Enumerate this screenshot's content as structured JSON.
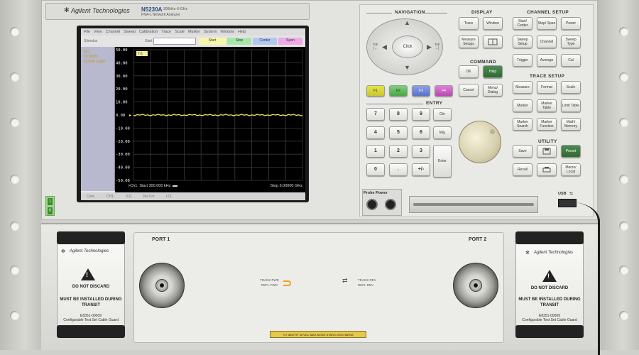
{
  "instrument": {
    "brand": "Agilent Technologies",
    "model": "N5230A",
    "model_range": "300kHz–6 GHz",
    "model_sub": "PNA-L Network Analyzer"
  },
  "screen": {
    "menu": [
      "File",
      "View",
      "Channel",
      "Sweep",
      "Calibration",
      "Trace",
      "Scale",
      "Marker",
      "System",
      "Window",
      "Help"
    ],
    "toolbar": {
      "mode_label": "Stimulus",
      "start_label": "Start",
      "start_value": "",
      "buttons": {
        "start": "Start",
        "stop": "Stop",
        "center": "Center",
        "span": "Span"
      }
    },
    "trace_label": {
      "line1": "S11",
      "line2": "10.00dB/",
      "line3": "0.00dB  LogM"
    },
    "marker_flag": "Tr1",
    "y_ticks": [
      "50.00",
      "40.00",
      "30.00",
      "20.00",
      "10.00",
      "0.00",
      "-10.00",
      "-20.00",
      "-30.00",
      "-40.00",
      "-50.00"
    ],
    "status_left": ">Ch1: Start  300.000 kHz",
    "status_right": "Stop  6.00000 GHz",
    "bottom_bar": [
      "Cont.",
      "CH1:",
      "S11",
      "No Cor",
      "LCL"
    ],
    "trace_color": "#f3ee6a",
    "grid_color": "#3a3a3a"
  },
  "led": {
    "top": "1",
    "bottom": "0"
  },
  "panel": {
    "navigation": {
      "title": "NAVIGATION",
      "click": "Click",
      "tab_left": "Tab\n|←",
      "tab_right": "Tab\n→|"
    },
    "display": {
      "title": "DISPLAY",
      "keys": [
        "Trace",
        "Window",
        "Measure Setups",
        ""
      ]
    },
    "channel_setup": {
      "title": "CHANNEL SETUP",
      "keys": [
        "Start/ Center",
        "Stop/ Span",
        "Power",
        "Sweep Setup",
        "Channel",
        "Sweep Type",
        "Trigger",
        "Average",
        "Cal"
      ]
    },
    "command": {
      "title": "COMMAND",
      "keys": [
        "OK",
        "Help",
        "Cancel",
        "Menu/ Dialog"
      ]
    },
    "trace_setup": {
      "title": "TRACE SETUP",
      "keys": [
        "Measure",
        "Format",
        "Scale",
        "Marker",
        "Marker Table",
        "Limit Table",
        "Marker Search",
        "Marker Function",
        "Math/ Memory"
      ]
    },
    "function_keys": [
      "F1",
      "F2",
      "F3",
      "F4"
    ],
    "entry": {
      "title": "ENTRY",
      "keys": [
        "7",
        "8",
        "9",
        "G/n",
        "4",
        "5",
        "6",
        "M/µ",
        "1",
        "2",
        "3",
        "Enter",
        "0",
        ".",
        "+/-"
      ]
    },
    "utility": {
      "title": "UTILITY",
      "keys": [
        "Save",
        "",
        "Preset",
        "Recall",
        "",
        "Macro/ Local"
      ]
    },
    "probe_power": "Probe Power",
    "usb_label": "USB"
  },
  "test_set": {
    "port1": "PORT 1",
    "port2": "PORT 2",
    "fwd_line1": "TRANS FWD",
    "fwd_line2": "REFL FWD",
    "rev_line1": "TRANS REV",
    "rev_line2": "REFL REV",
    "warning_strip": "+27 dBm RF 35 VDC MAX  AVOID STATIC DISCHARGE"
  },
  "cable_guard": {
    "brand": "Agilent Technologies",
    "do_not_discard": "DO NOT DISCARD",
    "must_install": "MUST BE INSTALLED DURING TRANSIT",
    "part": "E8351-00009",
    "part_desc": "Configurable Test Set Cable Guard"
  }
}
